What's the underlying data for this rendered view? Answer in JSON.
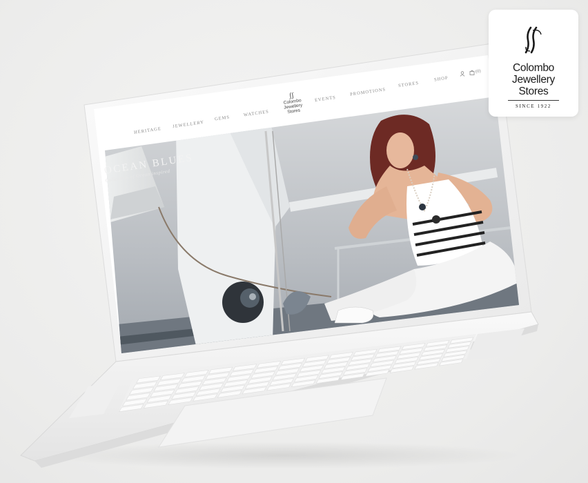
{
  "nav": {
    "items": [
      "HERITAGE",
      "JEWELLERY",
      "GEMS",
      "WATCHES",
      "EVENTS",
      "PROMOTIONS",
      "STORES",
      "SHOP"
    ],
    "logo_lines": [
      "Colombo",
      "Jewellery",
      "Stores"
    ],
    "cart_count": "(0)"
  },
  "hero": {
    "title": "OCEAN BLUES",
    "subtitle": "Collection of Ocean inspired"
  },
  "brand_card": {
    "line1": "Colombo",
    "line2": "Jewellery",
    "line3": "Stores",
    "since": "SINCE 1922"
  },
  "icons": {
    "user": "user-icon",
    "cart": "cart-icon",
    "monogram": "cjs-monogram-icon"
  },
  "colors": {
    "background": "#ececeb",
    "laptop_body": "#f7f7f7",
    "nav_text": "#8a8a8a",
    "hero_sky": "#c9ccd0"
  }
}
